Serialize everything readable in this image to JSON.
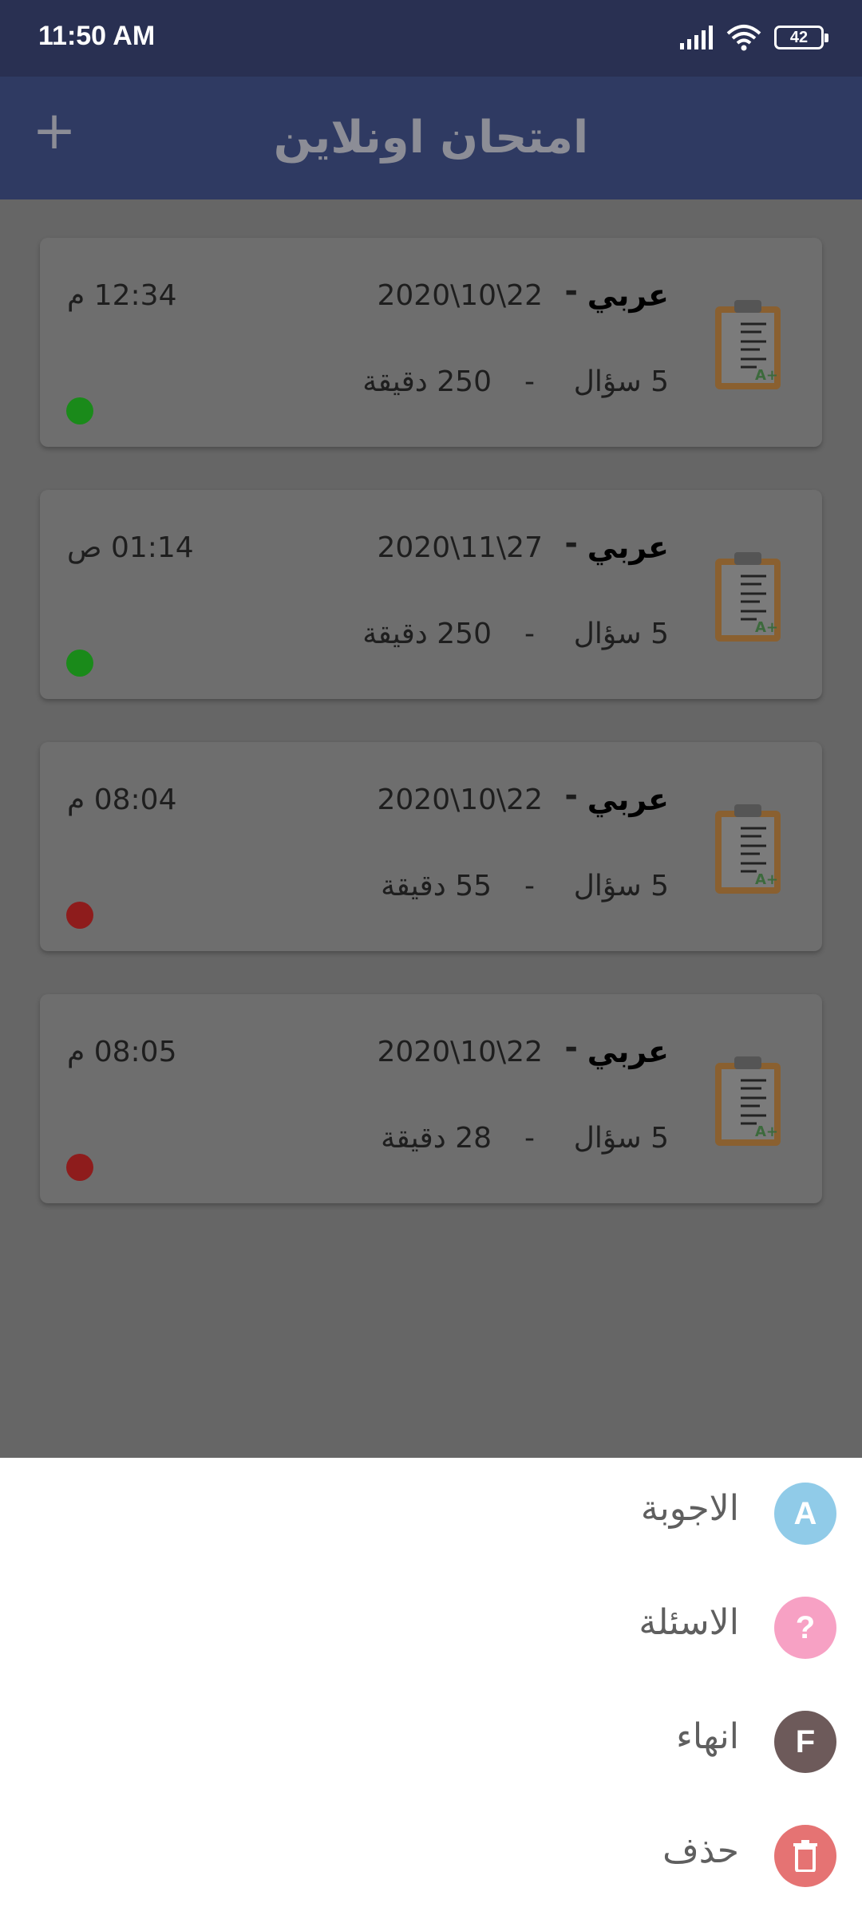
{
  "status_bar": {
    "time": "11:50 AM",
    "battery": "42"
  },
  "app_bar": {
    "title": "امتحان اونلاين",
    "add_icon": "+"
  },
  "exams": [
    {
      "subject": "عربي",
      "date": "2020\\10\\22",
      "time": "12:34 م",
      "questions": "5 سؤال",
      "duration": "250 دقيقة",
      "status_color": "#1a8a1a"
    },
    {
      "subject": "عربي",
      "date": "2020\\11\\27",
      "time": "01:14 ص",
      "questions": "5 سؤال",
      "duration": "250 دقيقة",
      "status_color": "#1a8a1a"
    },
    {
      "subject": "عربي",
      "date": "2020\\10\\22",
      "time": "08:04 م",
      "questions": "5 سؤال",
      "duration": "55 دقيقة",
      "status_color": "#8e1c1c"
    },
    {
      "subject": "عربي",
      "date": "2020\\10\\22",
      "time": "08:05 م",
      "questions": "5 سؤال",
      "duration": "28 دقيقة",
      "status_color": "#8e1c1c"
    }
  ],
  "separator": "-",
  "sheet": {
    "items": [
      {
        "label": "الاجوبة",
        "icon_text": "A",
        "icon": "answers-icon",
        "color": "#90cbe8"
      },
      {
        "label": "الاسئلة",
        "icon_text": "?",
        "icon": "question-icon",
        "color": "#f7a1c4"
      },
      {
        "label": "انهاء",
        "icon_text": "F",
        "icon": "finish-icon",
        "color": "#6d5a5a"
      },
      {
        "label": "حذف",
        "icon_text": "",
        "icon": "trash-icon",
        "color": "#e57373"
      }
    ]
  }
}
